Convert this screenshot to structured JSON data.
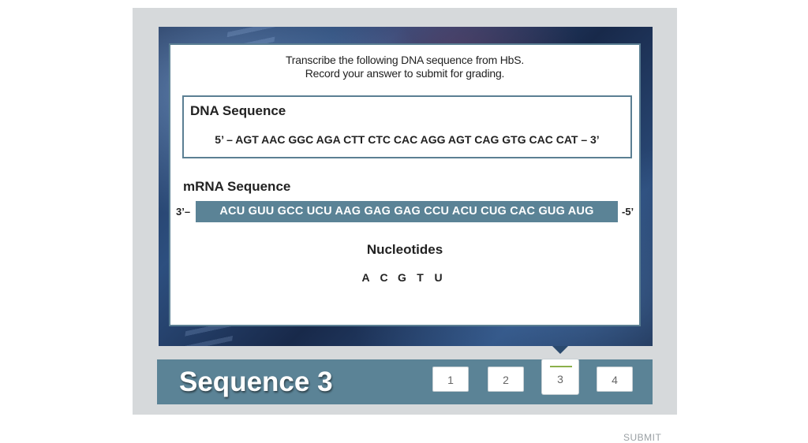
{
  "instructions": {
    "line1": "Transcribe the following DNA sequence from HbS.",
    "line2": "Record your answer to submit for grading."
  },
  "dna": {
    "title": "DNA Sequence",
    "sequence": "5’ – AGT AAC GGC AGA CTT CTC CAC AGG AGT CAG GTG CAC CAT – 3’"
  },
  "mrna": {
    "title": "mRNA Sequence",
    "prime_left": "3’–",
    "value": "ACU GUU GCC UCU AAG GAG GAG CCU ACU CUG CAC GUG AUG",
    "prime_right": "-5’"
  },
  "nucleotides": {
    "title": "Nucleotides",
    "items": [
      "A",
      "C",
      "G",
      "T",
      "U"
    ]
  },
  "footer": {
    "sequence_title": "Sequence 3",
    "steps": [
      "1",
      "2",
      "3",
      "4"
    ],
    "active_step": "3",
    "submit_label": "SUBMIT"
  },
  "colors": {
    "accent": "#5b8396",
    "card_border": "#5b7f93",
    "active_indicator": "#8bb04a"
  }
}
